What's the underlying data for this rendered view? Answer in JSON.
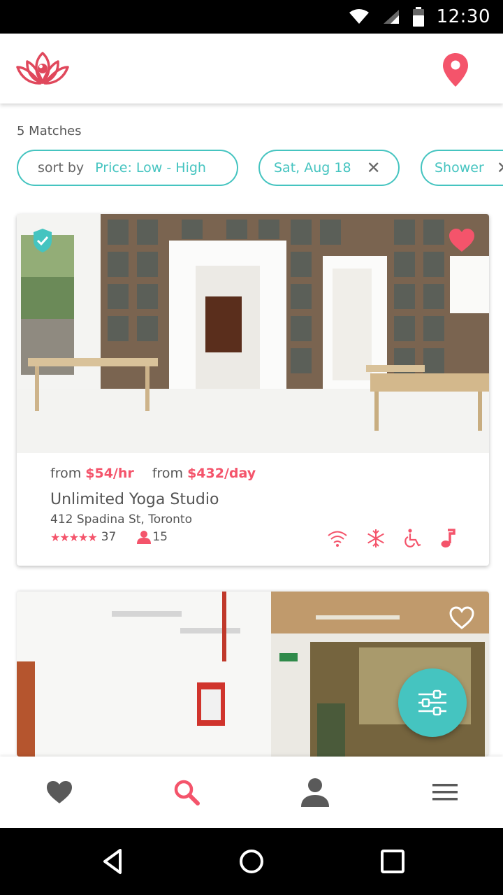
{
  "status_bar": {
    "time": "12:30",
    "icons": [
      "wifi-icon",
      "signal-icon",
      "battery-icon"
    ]
  },
  "header": {
    "logo": "lotus-logo",
    "location_icon": "map-pin-icon"
  },
  "results": {
    "matches_label": "5 Matches"
  },
  "filters": {
    "sort_label": "sort by",
    "sort_value": "Price: Low - High",
    "date_chip": "Sat, Aug 18",
    "amenity_chip": "Shower",
    "clear_symbol": "✕"
  },
  "listings": [
    {
      "from_label_1": "from",
      "price_hour": "$54/hr",
      "from_label_2": "from",
      "price_day": "$432/day",
      "title": "Unlimited Yoga Studio",
      "address": "412 Spadina St, Toronto",
      "stars": "★★★★★",
      "rating_count": "37",
      "capacity": "15",
      "verified": true,
      "favorited": true,
      "amenities": [
        "wifi-icon",
        "snowflake-icon",
        "wheelchair-icon",
        "music-note-icon"
      ]
    },
    {
      "favorited": false
    }
  ],
  "bottom_nav": [
    "heart-icon",
    "search-icon",
    "user-icon",
    "menu-icon"
  ],
  "colors": {
    "accent_pink": "#f4546b",
    "accent_teal": "#45c4c0",
    "text_gray": "#555555",
    "icon_gray": "#5a5a5a"
  }
}
